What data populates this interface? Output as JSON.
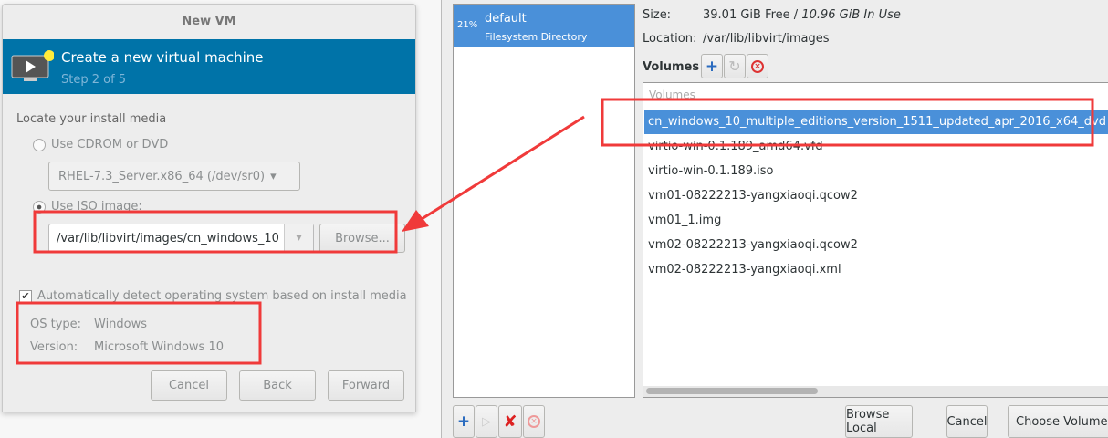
{
  "new_vm": {
    "title": "New VM",
    "header_title": "Create a new virtual machine",
    "header_step": "Step 2 of 5",
    "section_label": "Locate your install media",
    "cdrom_label": "Use CDROM or DVD",
    "cdrom_value": "RHEL-7.3_Server.x86_64 (/dev/sr0)",
    "iso_label": "Use ISO image:",
    "iso_value": "/var/lib/libvirt/images/cn_windows_10",
    "browse_label": "Browse...",
    "autodetect_label": "Automatically detect operating system based on install media",
    "os_type_label": "OS type:",
    "os_type_value": "Windows",
    "version_label": "Version:",
    "version_value": "Microsoft Windows 10",
    "cancel_label": "Cancel",
    "back_label": "Back",
    "forward_label": "Forward"
  },
  "storage": {
    "pool": {
      "usage": "21%",
      "name": "default",
      "type": "Filesystem Directory"
    },
    "size_label": "Size:",
    "size_free": "39.01 GiB Free / ",
    "size_used": "10.96 GiB In Use",
    "location_label": "Location:",
    "location_value": "/var/lib/libvirt/images",
    "volumes_label": "Volumes",
    "volumes_column": "Volumes",
    "volumes": [
      "cn_windows_10_multiple_editions_version_1511_updated_apr_2016_x64_dvd",
      "virtio-win-0.1.189_amd64.vfd",
      "virtio-win-0.1.189.iso",
      "vm01-08222213-yangxiaoqi.qcow2",
      "vm01_1.img",
      "vm02-08222213-yangxiaoqi.qcow2",
      "vm02-08222213-yangxiaoqi.xml"
    ],
    "browse_local_label": "Browse Local",
    "cancel_label": "Cancel",
    "choose_label": "Choose Volume"
  },
  "colors": {
    "accent": "#0073a8",
    "selection": "#4a90d9",
    "annotation": "#f03a3a"
  }
}
